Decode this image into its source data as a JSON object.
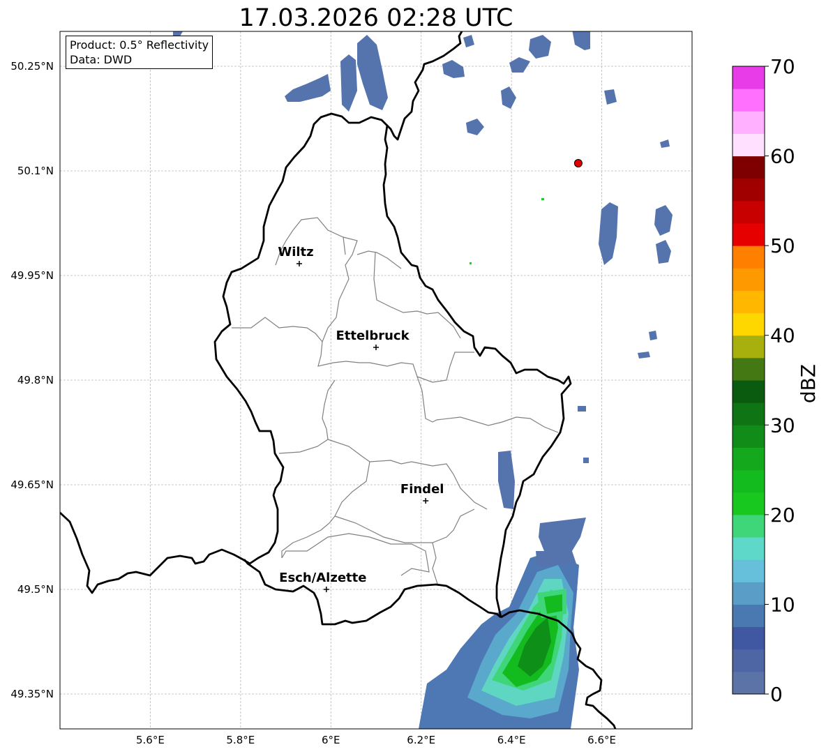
{
  "title": "17.03.2026 02:28 UTC",
  "info": {
    "product": "Product: 0.5° Reflectivity",
    "data": "Data: DWD"
  },
  "map": {
    "lon_range": [
      5.4,
      6.8
    ],
    "lat_range": [
      49.3,
      50.3
    ],
    "lat_ticks": [
      {
        "value": 50.25,
        "label": "50.25°N"
      },
      {
        "value": 50.1,
        "label": "50.1°N"
      },
      {
        "value": 49.95,
        "label": "49.95°N"
      },
      {
        "value": 49.8,
        "label": "49.8°N"
      },
      {
        "value": 49.65,
        "label": "49.65°N"
      },
      {
        "value": 49.5,
        "label": "49.5°N"
      },
      {
        "value": 49.35,
        "label": "49.35°N"
      }
    ],
    "lon_ticks": [
      {
        "value": 5.6,
        "label": "5.6°E"
      },
      {
        "value": 5.8,
        "label": "5.8°E"
      },
      {
        "value": 6.0,
        "label": "6°E"
      },
      {
        "value": 6.2,
        "label": "6.2°E"
      },
      {
        "value": 6.4,
        "label": "6.4°E"
      },
      {
        "value": 6.6,
        "label": "6.6°E"
      }
    ],
    "cities": [
      {
        "name": "Wiltz",
        "lon": 5.93,
        "lat": 49.967
      },
      {
        "name": "Ettelbruck",
        "lon": 6.1,
        "lat": 49.847
      },
      {
        "name": "Findel",
        "lon": 6.21,
        "lat": 49.627
      },
      {
        "name": "Esch/Alzette",
        "lon": 5.99,
        "lat": 49.5
      }
    ],
    "radar_site": {
      "lon": 6.548,
      "lat": 50.111,
      "color": "#e00000"
    }
  },
  "colorbar": {
    "label": "dBZ",
    "min": 0,
    "max": 70,
    "ticks": [
      0,
      10,
      20,
      30,
      40,
      50,
      60,
      70
    ],
    "colors": [
      "#5c73a8",
      "#4f66a5",
      "#4058a2",
      "#4a78b0",
      "#5a9ec8",
      "#66c0dc",
      "#5ed8c8",
      "#3fd67a",
      "#18c81f",
      "#14bb1f",
      "#14a81c",
      "#128c18",
      "#0e7414",
      "#0a5a10",
      "#437813",
      "#a8b00e",
      "#ffd700",
      "#ffb700",
      "#ff9900",
      "#ff7f00",
      "#e60000",
      "#c80000",
      "#a00000",
      "#7f0000",
      "#ffe0ff",
      "#ffb0ff",
      "#ff70ff",
      "#e83ce8"
    ]
  }
}
